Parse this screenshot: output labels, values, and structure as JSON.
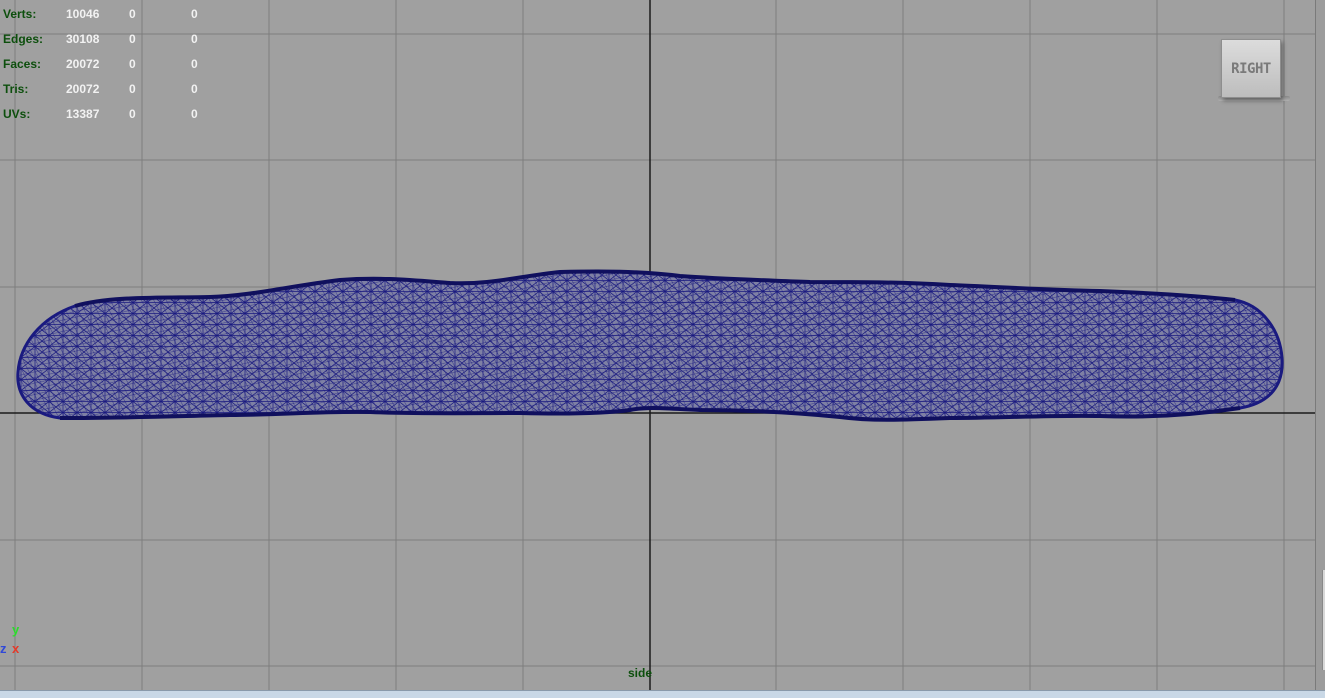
{
  "hud": {
    "rows": [
      {
        "label": "Verts:",
        "v1": "10046",
        "v2": "0",
        "v3": "0"
      },
      {
        "label": "Edges:",
        "v1": "30108",
        "v2": "0",
        "v3": "0"
      },
      {
        "label": "Faces:",
        "v1": "20072",
        "v2": "0",
        "v3": "0"
      },
      {
        "label": "Tris:",
        "v1": "20072",
        "v2": "0",
        "v3": "0"
      },
      {
        "label": "UVs:",
        "v1": "13387",
        "v2": "0",
        "v3": "0"
      }
    ]
  },
  "view_cube": {
    "label": "RIGHT"
  },
  "camera": {
    "name": "side"
  },
  "axis": {
    "y": "y",
    "x": "x",
    "z": "z"
  },
  "colors": {
    "background": "#a0a0a0",
    "grid": "#7e7e7e",
    "axis_line": "#1a1a1a",
    "mesh_wire": "#1a1a80",
    "mesh_fill": "#3a3f88",
    "hud_label": "#0d4f0d",
    "hud_value": "#f2f2f2"
  },
  "mesh": {
    "type": "wireframe",
    "icon": "mesh-wireframe"
  }
}
